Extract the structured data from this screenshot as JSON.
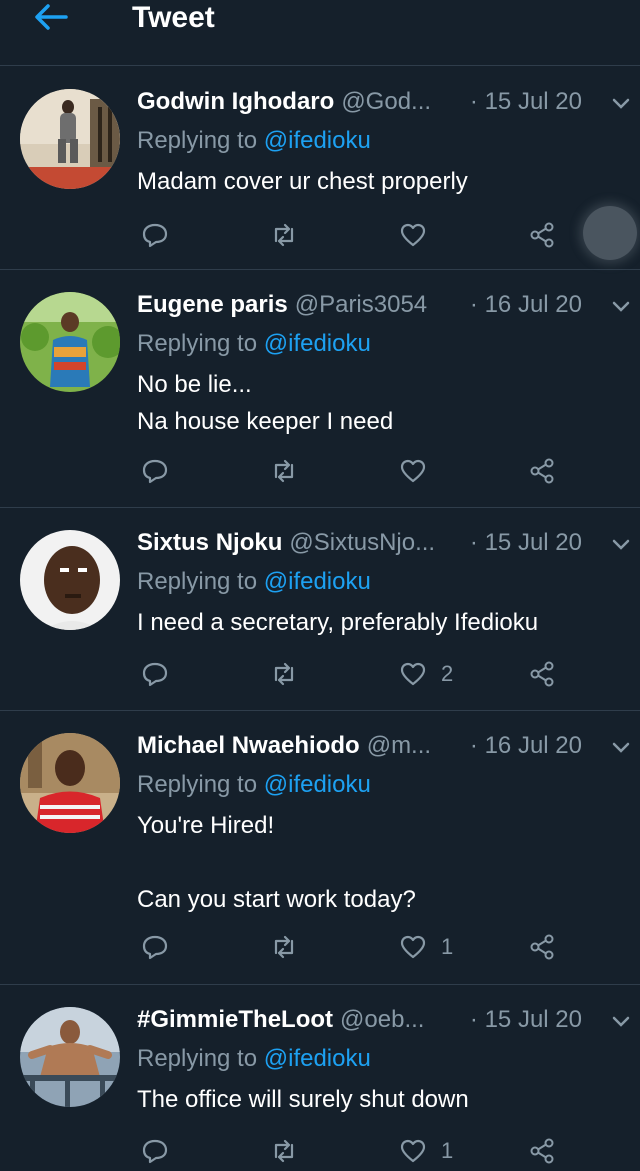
{
  "header": {
    "title": "Tweet",
    "back_icon": "arrow-left-icon",
    "accent": "#1da1f2"
  },
  "colors": {
    "background": "#15202b",
    "secondary_text": "#8899a6",
    "divider": "#2f3d4b",
    "mention": "#1da1f2"
  },
  "tweets": [
    {
      "name": "Godwin Ighodaro",
      "handle": "@God...",
      "date": "· 15 Jul 20",
      "replying_label": "Replying to",
      "replying_to": "@ifedioku",
      "text": "Madam cover ur chest properly",
      "likes": ""
    },
    {
      "name": "Eugene paris",
      "handle": "@Paris3054",
      "date": "· 16 Jul 20",
      "replying_label": "Replying to",
      "replying_to": "@ifedioku",
      "text": "No be lie...\nNa house keeper I need",
      "likes": ""
    },
    {
      "name": "Sixtus Njoku",
      "handle": "@SixtusNjo...",
      "date": "· 15 Jul 20",
      "replying_label": "Replying to",
      "replying_to": "@ifedioku",
      "text": "I need a secretary, preferably Ifedioku",
      "likes": "2"
    },
    {
      "name": "Michael Nwaehiodo",
      "handle": "@m...",
      "date": "· 16 Jul 20",
      "replying_label": "Replying to",
      "replying_to": "@ifedioku",
      "text": "You're Hired!\n\nCan you start work today?",
      "likes": "1"
    },
    {
      "name": "#GimmieTheLoot",
      "handle": "@oeb...",
      "date": "· 15 Jul 20",
      "replying_label": "Replying to",
      "replying_to": "@ifedioku",
      "text": "The office will surely shut down",
      "likes": "1"
    }
  ]
}
